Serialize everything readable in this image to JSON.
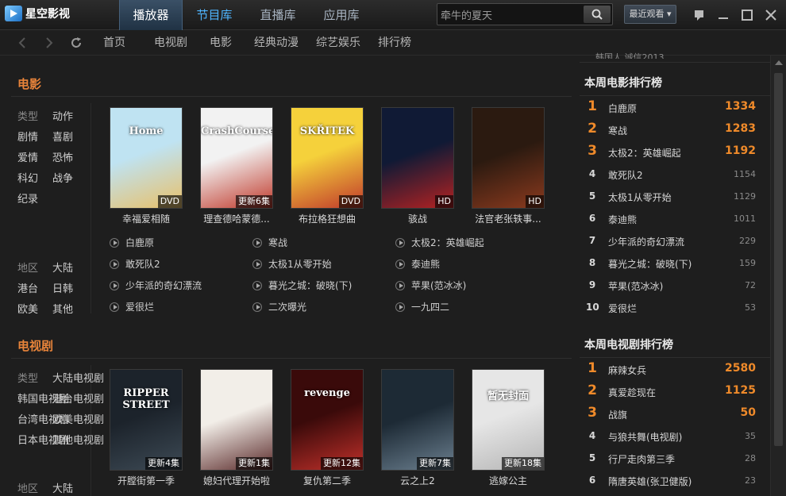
{
  "app": {
    "title": "星空影视"
  },
  "main_tabs": [
    {
      "label": "播放器"
    },
    {
      "label": "节目库"
    },
    {
      "label": "直播库"
    },
    {
      "label": "应用库"
    }
  ],
  "search": {
    "value": "牵牛的夏天"
  },
  "recent_button": {
    "label": "最近观看"
  },
  "nav_tabs": [
    {
      "label": "首页"
    },
    {
      "label": "电视剧"
    },
    {
      "label": "电影"
    },
    {
      "label": "经典动漫"
    },
    {
      "label": "综艺娱乐"
    },
    {
      "label": "排行榜"
    }
  ],
  "movies": {
    "title": "电影",
    "filters": {
      "type_label": "类型",
      "types": [
        "动作",
        "剧情",
        "喜剧",
        "爱情",
        "恐怖",
        "科幻",
        "战争",
        "纪录"
      ],
      "region_label": "地区",
      "regions": [
        "大陆",
        "港台",
        "日韩",
        "欧美",
        "其他"
      ]
    },
    "posters": [
      {
        "caption": "幸福爱相随",
        "badge": "DVD",
        "art": "Home",
        "color1": "#bfe3f2",
        "color2": "#e8c06a"
      },
      {
        "caption": "理查德哈蒙德...",
        "badge": "更新6集",
        "art": "CrashCourse",
        "color1": "#f2f2f2",
        "color2": "#c0392b"
      },
      {
        "caption": "布拉格狂想曲",
        "badge": "DVD",
        "art": "SKŘITEK",
        "color1": "#f5d13b",
        "color2": "#c0392b"
      },
      {
        "caption": "骇战",
        "badge": "HD",
        "art": "",
        "color1": "#101a35",
        "color2": "#b52222"
      },
      {
        "caption": "法官老张轶事...",
        "badge": "HD",
        "art": "",
        "color1": "#2b1a10",
        "color2": "#8b3a1e"
      }
    ],
    "links": [
      [
        "白鹿原",
        "寒战",
        "太极2：英雄崛起"
      ],
      [
        "敢死队2",
        "太极1从零开始",
        "泰迪熊"
      ],
      [
        "少年派的奇幻漂流",
        "暮光之城：破晓(下)",
        "苹果(范冰冰)"
      ],
      [
        "爱很烂",
        "二次曝光",
        "一九四二"
      ]
    ]
  },
  "tv": {
    "title": "电视剧",
    "filters": {
      "type_label": "类型",
      "types": [
        "大陆电视剧",
        "韩国电视剧",
        "港台电视剧",
        "台湾电视剧",
        "欧美电视剧",
        "日本电视剧",
        "其他电视剧"
      ],
      "region_label": "地区",
      "region_first": "大陆"
    },
    "posters": [
      {
        "caption": "开膛街第一季",
        "badge": "更新4集",
        "art": "RIPPER STREET",
        "color1": "#1c232b",
        "color2": "#3d4a55"
      },
      {
        "caption": "媳妇代理开始啦",
        "badge": "更新1集",
        "art": "",
        "color1": "#f2eee8",
        "color2": "#5a2a2a"
      },
      {
        "caption": "复仇第二季",
        "badge": "更新12集",
        "art": "revenge",
        "color1": "#3a0a0a",
        "color2": "#c0302a"
      },
      {
        "caption": "云之上2",
        "badge": "更新7集",
        "art": "",
        "color1": "#1d2a35",
        "color2": "#6b7f8f"
      },
      {
        "caption": "逃嫁公主",
        "badge": "更新18集",
        "art": "暂无封面",
        "color1": "#e6e6e6",
        "color2": "#b5b5b5"
      }
    ]
  },
  "rankings": {
    "clipped_text": "韩国人 诚信2013",
    "movie_title": "本周电影排行榜",
    "movie": [
      {
        "rank": "1",
        "name": "白鹿原",
        "score": "1334"
      },
      {
        "rank": "2",
        "name": "寒战",
        "score": "1283"
      },
      {
        "rank": "3",
        "name": "太极2：英雄崛起",
        "score": "1192"
      },
      {
        "rank": "4",
        "name": "敢死队2",
        "score": "1154"
      },
      {
        "rank": "5",
        "name": "太极1从零开始",
        "score": "1129"
      },
      {
        "rank": "6",
        "name": "泰迪熊",
        "score": "1011"
      },
      {
        "rank": "7",
        "name": "少年派的奇幻漂流",
        "score": "229"
      },
      {
        "rank": "8",
        "name": "暮光之城：破晓(下)",
        "score": "159"
      },
      {
        "rank": "9",
        "name": "苹果(范冰冰)",
        "score": "72"
      },
      {
        "rank": "10",
        "name": "爱很烂",
        "score": "53"
      }
    ],
    "tv_title": "本周电视剧排行榜",
    "tv": [
      {
        "rank": "1",
        "name": "麻辣女兵",
        "score": "2580"
      },
      {
        "rank": "2",
        "name": "真爱趁现在",
        "score": "1125"
      },
      {
        "rank": "3",
        "name": "战旗",
        "score": "50"
      },
      {
        "rank": "4",
        "name": "与狼共舞(电视剧)",
        "score": "35"
      },
      {
        "rank": "5",
        "name": "行尸走肉第三季",
        "score": "28"
      },
      {
        "rank": "6",
        "name": "隋唐英雄(张卫健版)",
        "score": "23"
      }
    ]
  },
  "icons": {
    "search": "search-icon",
    "back": "arrow-left-icon",
    "forward": "arrow-right-icon",
    "refresh": "refresh-icon",
    "feedback": "feedback-icon",
    "minimize": "minimize-icon",
    "maximize": "maximize-icon",
    "close": "close-icon"
  },
  "colors": {
    "accent": "#e8843a",
    "rank_top": "#ef8a2a",
    "tab_active": "#4fb5ff"
  }
}
